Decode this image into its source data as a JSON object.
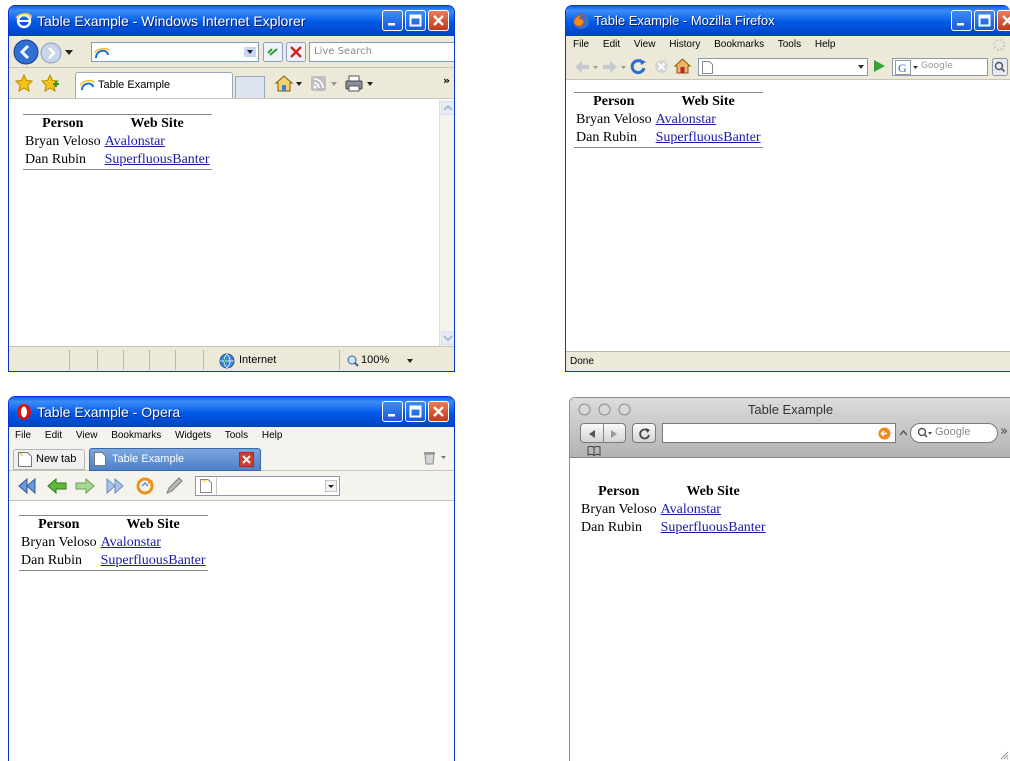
{
  "table": {
    "headers": [
      "Person",
      "Web Site"
    ],
    "rows": [
      {
        "person": "Bryan Veloso",
        "site": "Avalonstar"
      },
      {
        "person": "Dan Rubin",
        "site": "SuperfluousBanter"
      }
    ]
  },
  "ie": {
    "title": "Table Example - Windows Internet Explorer",
    "search_placeholder": "Live Search",
    "tab_label": "Table Example",
    "status_zone": "Internet",
    "zoom": "100%"
  },
  "firefox": {
    "title": "Table Example - Mozilla Firefox",
    "menu": [
      "File",
      "Edit",
      "View",
      "History",
      "Bookmarks",
      "Tools",
      "Help"
    ],
    "search_placeholder": "Google",
    "status": "Done"
  },
  "opera": {
    "title": "Table Example - Opera",
    "menu": [
      "File",
      "Edit",
      "View",
      "Bookmarks",
      "Widgets",
      "Tools",
      "Help"
    ],
    "tabs": [
      "New tab",
      "Table Example"
    ]
  },
  "safari": {
    "title": "Table Example",
    "search_placeholder": "Google"
  },
  "colors": {
    "xp_blue": "#0058e6",
    "link": "#1a1aa6",
    "close_red": "#c23a17"
  }
}
